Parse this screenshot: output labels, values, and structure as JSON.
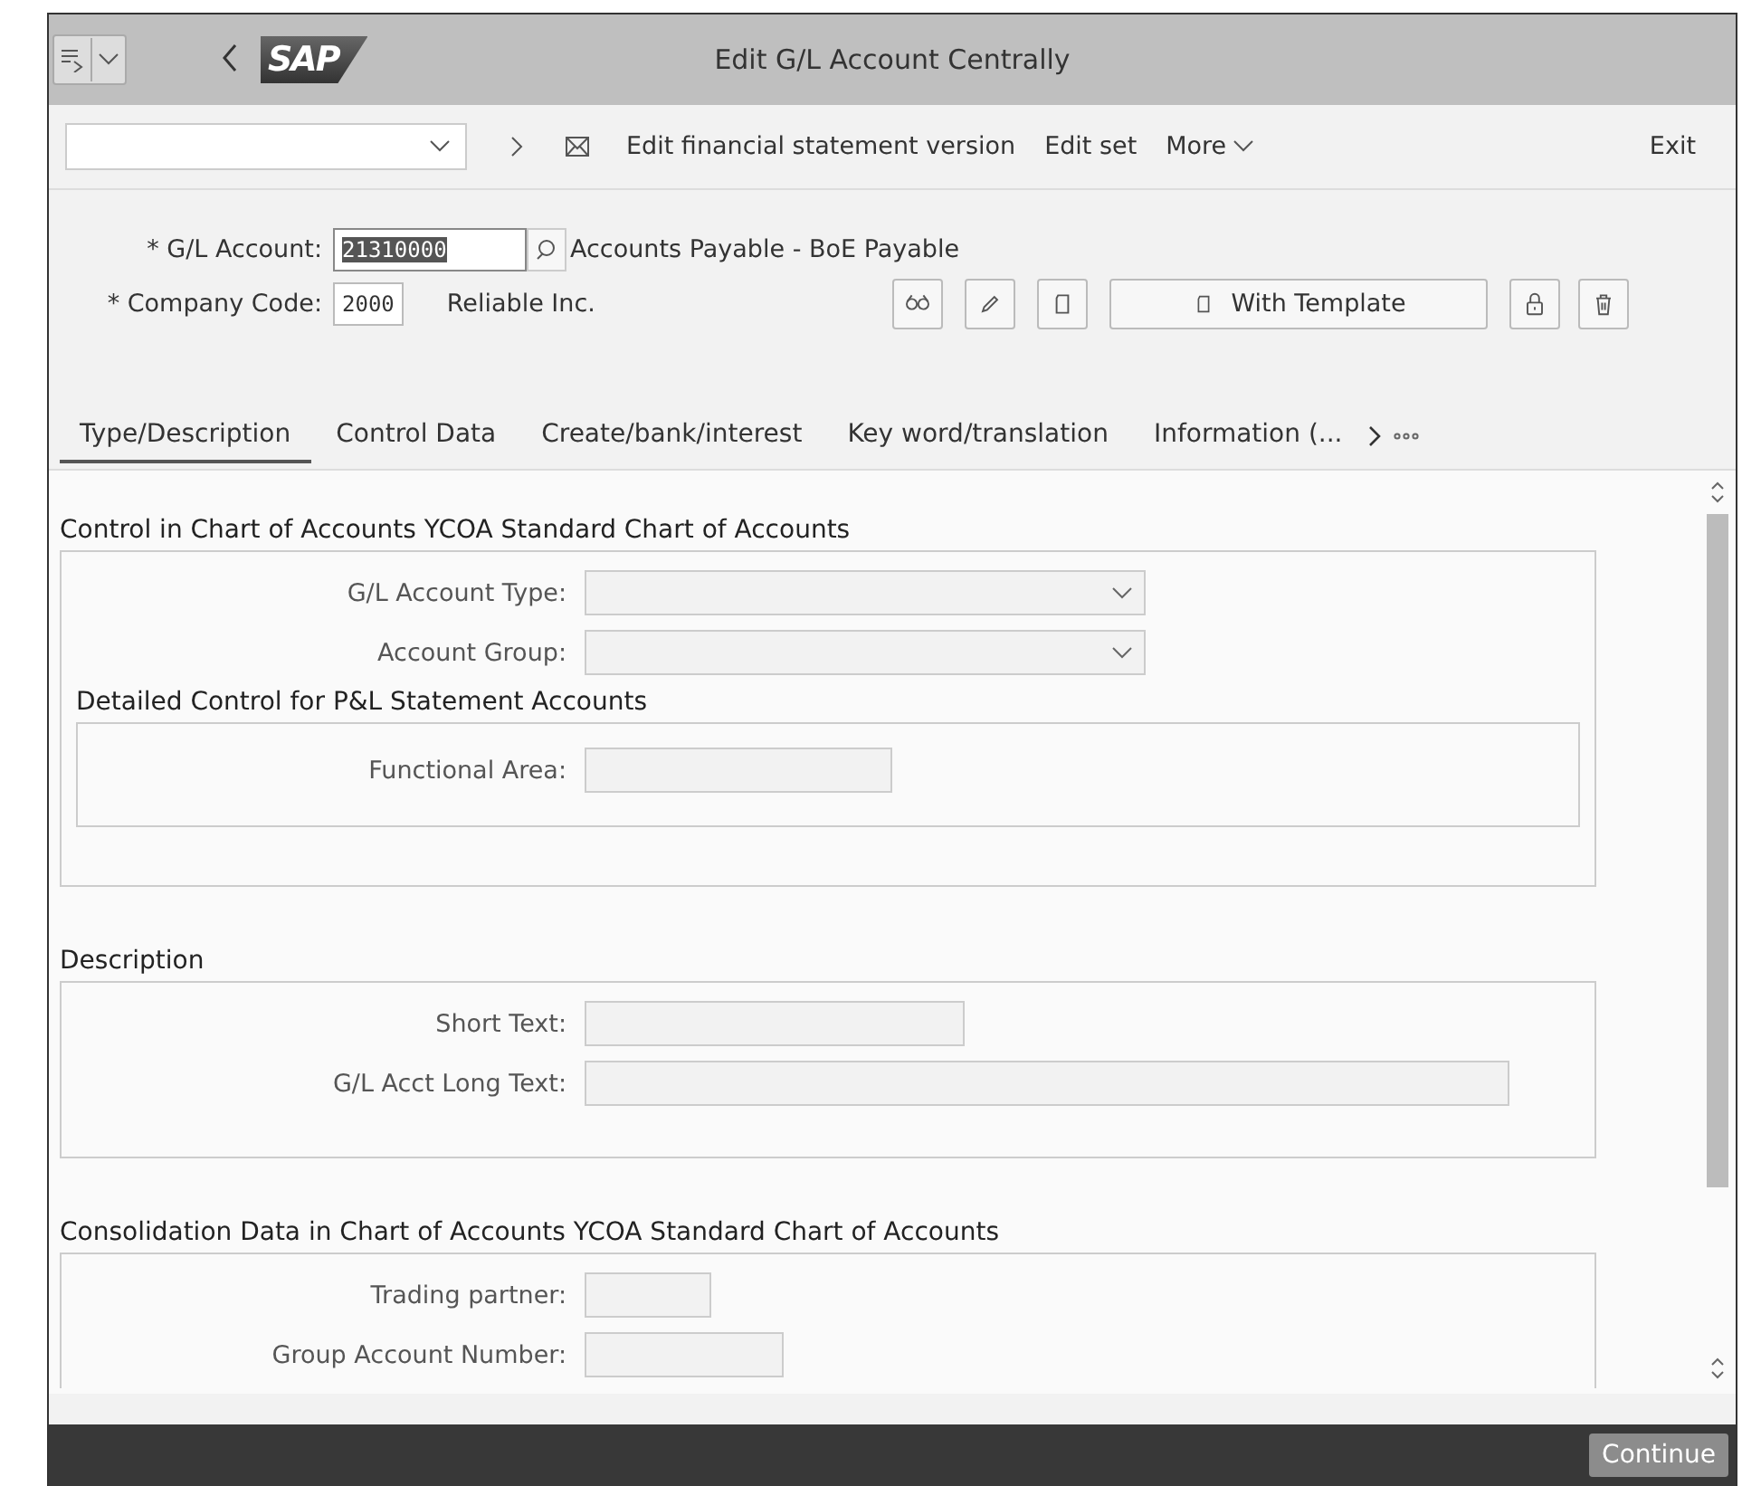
{
  "title_bar": {
    "logo": "SAP",
    "title": "Edit G/L Account Centrally"
  },
  "toolbar": {
    "actions": [
      "Edit financial statement version",
      "Edit set",
      "More"
    ],
    "exit": "Exit"
  },
  "header": {
    "fields": [
      {
        "label": "* G/L Account:",
        "value": "21310000",
        "value_selected": true,
        "description": "Accounts Payable - BoE Payable"
      },
      {
        "label": "* Company Code:",
        "value": "2000",
        "value_selected": false,
        "description": "Reliable Inc."
      }
    ],
    "template_button": "With Template"
  },
  "tabs": [
    {
      "label": "Type/Description",
      "selected": true
    },
    {
      "label": "Control Data",
      "selected": false
    },
    {
      "label": "Create/bank/interest",
      "selected": false
    },
    {
      "label": "Key word/translation",
      "selected": false
    },
    {
      "label": "Information (...",
      "selected": false
    }
  ],
  "sections": [
    {
      "title": "Control in Chart of Accounts YCOA Standard Chart of Accounts",
      "fields": [
        {
          "label": "G/L Account Type:",
          "kind": "dropdown"
        },
        {
          "label": "Account Group:",
          "kind": "dropdown"
        }
      ],
      "subsections": [
        {
          "title": "Detailed Control for P&L Statement Accounts",
          "fields": [
            {
              "label": "Functional Area:",
              "kind": "input"
            }
          ]
        }
      ]
    },
    {
      "title": "Description",
      "fields": [
        {
          "label": "Short Text:",
          "kind": "input"
        },
        {
          "label": "G/L Acct Long Text:",
          "kind": "input"
        }
      ]
    },
    {
      "title": "Consolidation Data in Chart of Accounts YCOA Standard Chart of Accounts",
      "fields": [
        {
          "label": "Trading partner:",
          "kind": "input"
        },
        {
          "label": "Group Account Number:",
          "kind": "input"
        }
      ]
    }
  ],
  "footer": {
    "button": "Continue"
  }
}
